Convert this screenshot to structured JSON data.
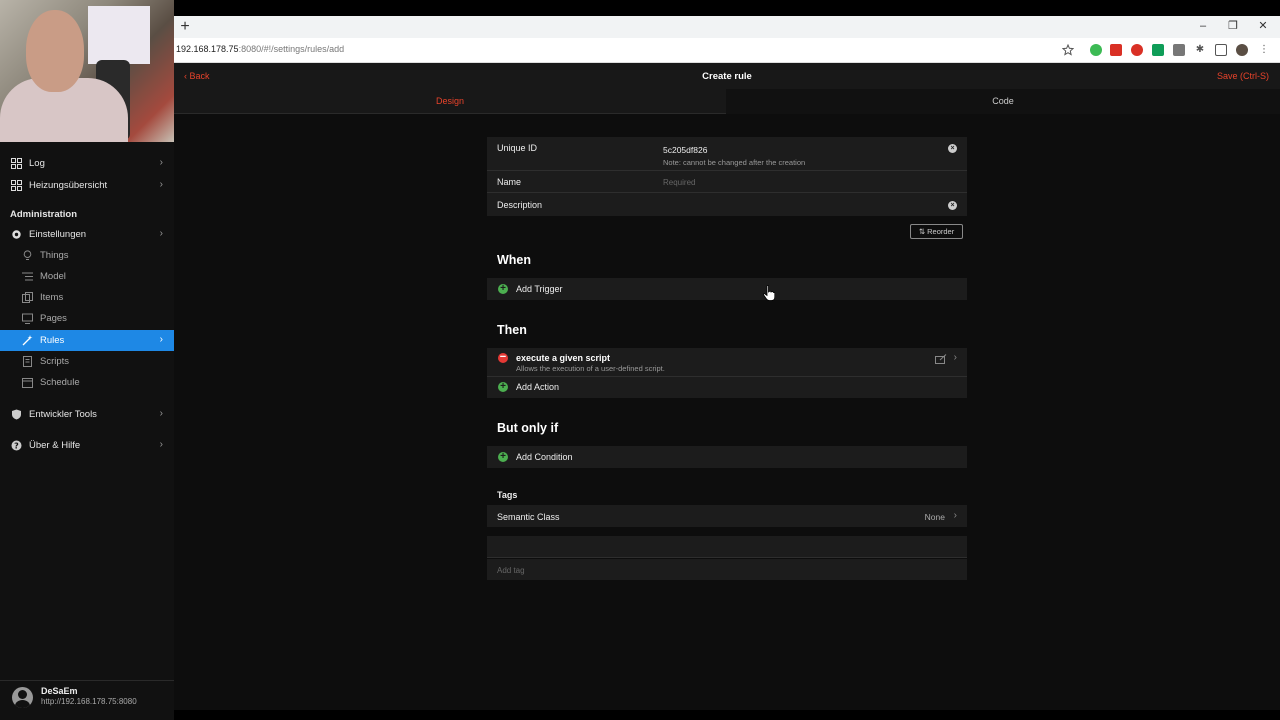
{
  "browser": {
    "url_host": "192.168.178.75",
    "url_path": ":8080/#!/settings/rules/add",
    "new_tab": "+",
    "minimize": "–",
    "restore": "❐",
    "close": "✕"
  },
  "sidebar": {
    "items": [
      {
        "label": "Log"
      },
      {
        "label": "Heizungsübersicht"
      }
    ],
    "admin_header": "Administration",
    "settings": {
      "label": "Einstellungen"
    },
    "sub_items": [
      {
        "label": "Things"
      },
      {
        "label": "Model"
      },
      {
        "label": "Items"
      },
      {
        "label": "Pages"
      },
      {
        "label": "Rules"
      },
      {
        "label": "Scripts"
      },
      {
        "label": "Schedule"
      }
    ],
    "dev_tools": {
      "label": "Entwickler Tools"
    },
    "help": {
      "label": "Über & Hilfe"
    },
    "user": {
      "name": "DeSaEm",
      "url": "http://192.168.178.75:8080"
    }
  },
  "navbar": {
    "back_label": "Back",
    "title": "Create rule",
    "save_label": "Save (Ctrl-S)"
  },
  "tabs": {
    "design": "Design",
    "code": "Code"
  },
  "form": {
    "uid_label": "Unique ID",
    "uid_value": "5c205df826",
    "uid_note": "Note: cannot be changed after the creation",
    "name_label": "Name",
    "name_placeholder": "Required",
    "desc_label": "Description",
    "reorder": "Reorder"
  },
  "when": {
    "header": "When",
    "add": "Add Trigger"
  },
  "then": {
    "header": "Then",
    "action_title": "execute a given script",
    "action_desc": "Allows the execution of a user-defined script.",
    "add": "Add Action"
  },
  "only_if": {
    "header": "But only if",
    "add": "Add Condition"
  },
  "tags": {
    "header": "Tags",
    "semantic_label": "Semantic Class",
    "semantic_value": "None",
    "add_tag": "Add tag"
  },
  "colors": {
    "accent": "#e8432b",
    "active_nav": "#1e88e5",
    "add": "#4caf50",
    "remove": "#e53935"
  }
}
